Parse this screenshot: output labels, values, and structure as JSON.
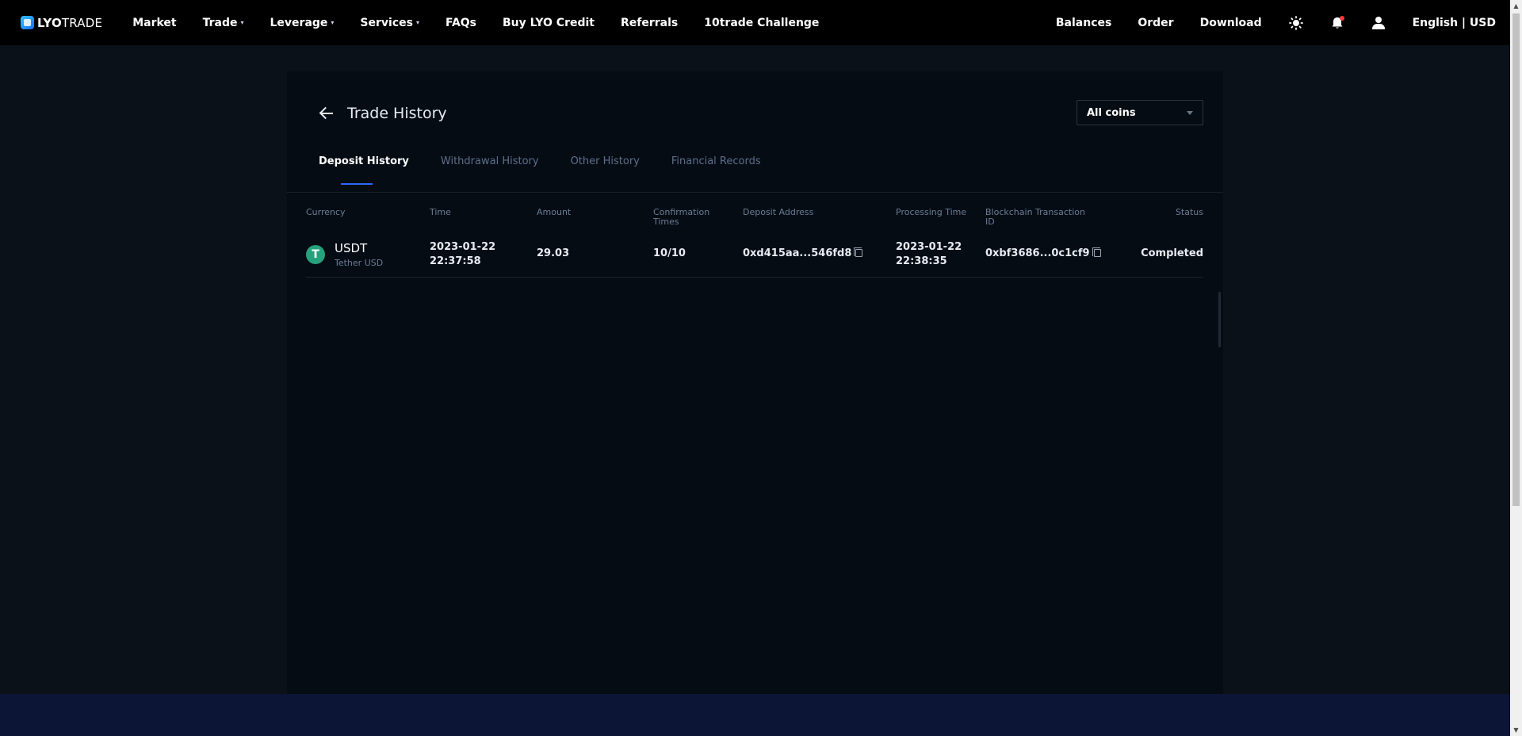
{
  "logo": {
    "brand_bold": "LYO",
    "brand_thin": "TRADE"
  },
  "nav": {
    "left": [
      {
        "label": "Market",
        "caret": false
      },
      {
        "label": "Trade",
        "caret": true
      },
      {
        "label": "Leverage",
        "caret": true
      },
      {
        "label": "Services",
        "caret": true
      },
      {
        "label": "FAQs",
        "caret": false
      },
      {
        "label": "Buy LYO Credit",
        "caret": false
      },
      {
        "label": "Referrals",
        "caret": false
      },
      {
        "label": "10trade Challenge",
        "caret": false
      }
    ],
    "right": {
      "balances": "Balances",
      "order": "Order",
      "download": "Download",
      "language": "English | USD"
    },
    "caret_glyph": "▾"
  },
  "page": {
    "title": "Trade History"
  },
  "coin_filter": {
    "selected": "All coins"
  },
  "tabs": [
    {
      "label": "Deposit History",
      "active": true
    },
    {
      "label": "Withdrawal History",
      "active": false
    },
    {
      "label": "Other History",
      "active": false
    },
    {
      "label": "Financial Records",
      "active": false
    }
  ],
  "table": {
    "headers": {
      "currency": "Currency",
      "time": "Time",
      "amount": "Amount",
      "confirmation_1": "Confirmation",
      "confirmation_2": "Times",
      "deposit_address": "Deposit Address",
      "processing_time": "Processing Time",
      "tx_id_1": "Blockchain Transaction",
      "tx_id_2": "ID",
      "status": "Status"
    },
    "rows": [
      {
        "coin_symbol": "USDT",
        "coin_name": "Tether USD",
        "coin_icon_glyph": "T",
        "time_date": "2023-01-22",
        "time_clock": "22:37:58",
        "amount": "29.03",
        "confirmations": "10/10",
        "deposit_address": "0xd415aa...546fd8",
        "processing_date": "2023-01-22",
        "processing_clock": "22:38:35",
        "tx_id": "0xbf3686...0c1cf9",
        "status": "Completed"
      }
    ]
  },
  "colors": {
    "accent": "#2b6af5",
    "tether_green": "#26a17b",
    "notification_dot": "#ff3b3b",
    "page_bg": "#0a1119",
    "panel_bg": "#060c14",
    "footer_bg": "#0c1535"
  },
  "icons": [
    "logo-icon",
    "back-arrow-icon",
    "chevron-down-icon",
    "sun-icon",
    "bell-icon",
    "user-icon",
    "copy-icon",
    "tether-icon"
  ]
}
